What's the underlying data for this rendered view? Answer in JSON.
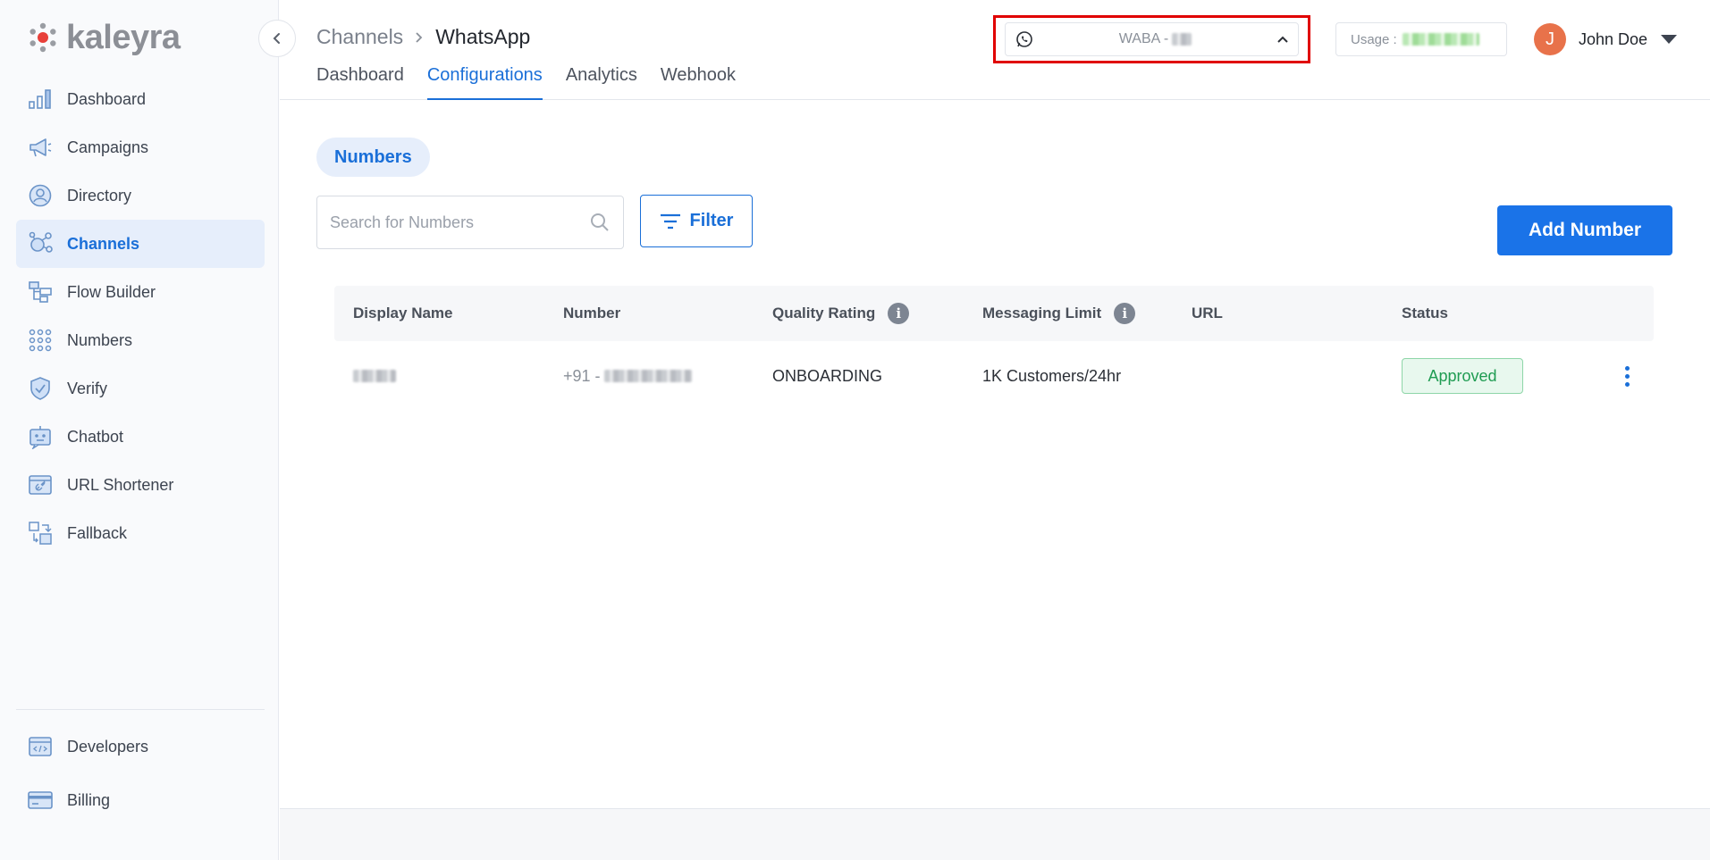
{
  "brand": {
    "name": "kaleyra",
    "accent": "#1a6fd8"
  },
  "sidebar": {
    "items": [
      {
        "label": "Dashboard",
        "icon": "chart-bars-icon"
      },
      {
        "label": "Campaigns",
        "icon": "megaphone-icon"
      },
      {
        "label": "Directory",
        "icon": "contact-icon"
      },
      {
        "label": "Channels",
        "icon": "channels-icon",
        "active": true
      },
      {
        "label": "Flow Builder",
        "icon": "flow-icon"
      },
      {
        "label": "Numbers",
        "icon": "dialpad-icon"
      },
      {
        "label": "Verify",
        "icon": "shield-check-icon"
      },
      {
        "label": "Chatbot",
        "icon": "robot-icon"
      },
      {
        "label": "URL Shortener",
        "icon": "link-icon"
      },
      {
        "label": "Fallback",
        "icon": "fallback-icon"
      }
    ],
    "bottom_items": [
      {
        "label": "Developers",
        "icon": "code-window-icon"
      },
      {
        "label": "Billing",
        "icon": "credit-card-icon"
      }
    ]
  },
  "header": {
    "breadcrumb": {
      "parent": "Channels",
      "current": "WhatsApp"
    },
    "tabs": [
      {
        "label": "Dashboard"
      },
      {
        "label": "Configurations",
        "active": true
      },
      {
        "label": "Analytics"
      },
      {
        "label": "Webhook"
      }
    ],
    "waba_selector": {
      "label": "WABA - "
    },
    "usage": {
      "label": "Usage :"
    },
    "user": {
      "initial": "J",
      "name": "John Doe"
    }
  },
  "main": {
    "section_pill": "Numbers",
    "search": {
      "placeholder": "Search for Numbers"
    },
    "filter_label": "Filter",
    "add_button_label": "Add Number",
    "table": {
      "headers": [
        "Display Name",
        "Number",
        "Quality Rating",
        "Messaging Limit",
        "URL",
        "Status"
      ],
      "rows": [
        {
          "display_name": "",
          "number_prefix": "+91 - ",
          "quality_rating": "ONBOARDING",
          "messaging_limit": "1K Customers/24hr",
          "url": "",
          "status": "Approved"
        }
      ]
    }
  }
}
